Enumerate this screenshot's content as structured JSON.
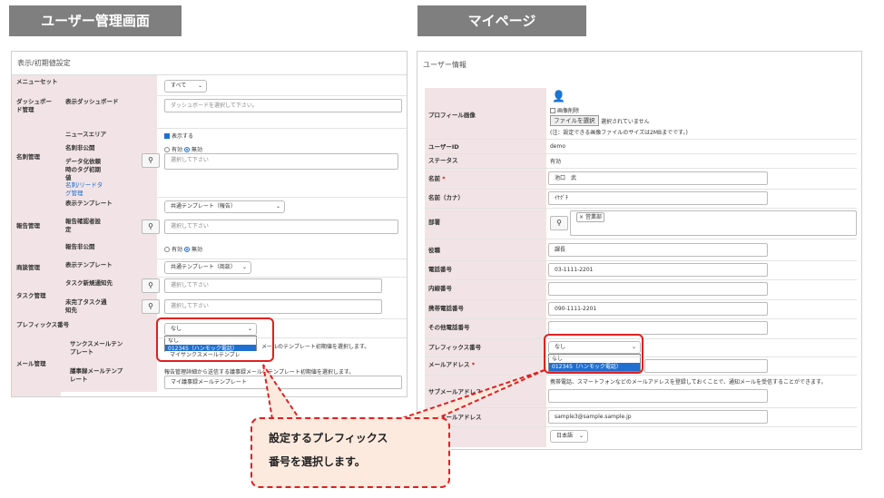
{
  "tabs": {
    "left_label": "ユーザー管理画面",
    "right_label": "マイページ"
  },
  "left_panel": {
    "title": "表示/初期値設定",
    "menu_set": {
      "label": "メニューセット",
      "value": "すべて"
    },
    "dashboard": {
      "label": "ダッシュボード管理",
      "sub_label": "表示ダッシュボード",
      "placeholder": "ダッシュボードを選択して下さい。"
    },
    "card_mgmt": {
      "label": "名刺管理",
      "news_area": {
        "label": "ニュースエリア",
        "option": "表示する"
      },
      "hide_card": {
        "label": "名刺非公開",
        "opt_yes": "有効",
        "opt_no": "無効"
      },
      "tag_init": {
        "label": "データ化依頼時のタグ初期値",
        "link": "名刺/リードタグ管理",
        "placeholder": "選択して下さい"
      }
    },
    "report_mgmt": {
      "label": "報告管理",
      "template": {
        "label": "表示テンプレート",
        "value": "共通テンプレート（報告）"
      },
      "confirm": {
        "label": "報告確認者設定",
        "placeholder": "選択して下さい"
      },
      "hide": {
        "label": "報告非公開",
        "opt_yes": "有効",
        "opt_no": "無効"
      }
    },
    "deal_mgmt": {
      "label": "商談管理",
      "template": {
        "label": "表示テンプレート",
        "value": "共通テンプレート（商談）"
      }
    },
    "task_mgmt": {
      "label": "タスク管理",
      "new_notify": {
        "label": "タスク新規通知先",
        "placeholder": "選択して下さい"
      },
      "undone_notify": {
        "label": "未完了タスク通知先",
        "placeholder": "選択して下さい"
      }
    },
    "prefix": {
      "label": "プレフィックス番号",
      "value": "なし",
      "options": [
        "なし",
        "012345（ハンモック電話）"
      ]
    },
    "mail_mgmt": {
      "label": "メール管理",
      "thanks": {
        "label": "サンクスメールテンプレート",
        "text": "メールのテンプレート初期値を選択します。",
        "value": "マイサンクスメールテンプレ"
      },
      "minutes": {
        "label": "議事録メールテンプレート",
        "text": "報告管理詳細から送信する議事録メールのテンプレート初期値を選択します。",
        "value": "マイ議事録メールテンプレート"
      }
    }
  },
  "right_panel": {
    "title": "ユーザー情報",
    "profile_image": {
      "label": "プロフィール画像",
      "delete_label": "画像削除",
      "file_button": "ファイルを選択",
      "file_status": "選択されていません",
      "note": "(注：設定できる画像ファイルのサイズは2MBまでです。)"
    },
    "user_id": {
      "label": "ユーザーID",
      "value": "demo"
    },
    "status": {
      "label": "ステータス",
      "value": "有効"
    },
    "name": {
      "label": "名前",
      "required": "*",
      "value": "池口　武"
    },
    "name_kana": {
      "label": "名前（カナ）",
      "value": "ｲｹｸﾞﾁ"
    },
    "department": {
      "label": "部署",
      "tag": "営業部"
    },
    "position": {
      "label": "役職",
      "value": "課長"
    },
    "phone": {
      "label": "電話番号",
      "value": "03-1111-2201"
    },
    "extension": {
      "label": "内線番号",
      "value": ""
    },
    "mobile": {
      "label": "携帯電話番号",
      "value": "090-1111-2201"
    },
    "other_phone": {
      "label": "その他電話番号",
      "value": ""
    },
    "prefix": {
      "label": "プレフィックス番号",
      "value": "なし",
      "options": [
        "なし",
        "012345（ハンモック電話）"
      ]
    },
    "email": {
      "label": "メールアドレス",
      "required": "*",
      "value": ""
    },
    "sub_email": {
      "label": "サブメールアドレス",
      "note": "携帯電話、スマートフォンなどのメールアドレスを登録しておくことで、通知メールを受信することができます。",
      "value": ""
    },
    "mobile_email": {
      "label": "携帯メールアドレス",
      "value": "sample3@sample.sample.jp"
    },
    "language": {
      "value": "日本語"
    }
  },
  "callout": {
    "line1": "設定するプレフィックス",
    "line2": "番号を選択します。"
  },
  "colors": {
    "label_bg": "#f2e4e6",
    "accent": "#1f6fd1",
    "highlight": "#e02020",
    "callout_bg": "#fdeadf",
    "tab_bg": "#7f7f7f"
  }
}
